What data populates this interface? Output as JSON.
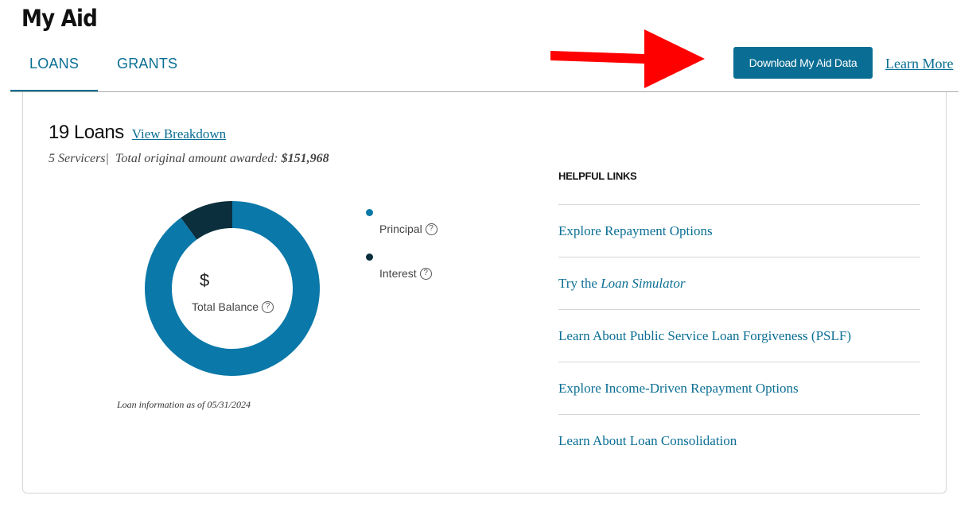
{
  "page": {
    "title": "My Aid"
  },
  "tabs": [
    {
      "label": "LOANS",
      "active": true
    },
    {
      "label": "GRANTS",
      "active": false
    }
  ],
  "actions": {
    "download_label": "Download My Aid Data",
    "learn_more_label": "Learn More"
  },
  "colors": {
    "accent": "#0a6e94",
    "principal": "#0a78a8",
    "interest": "#0b2f3c",
    "arrow": "#ff0000"
  },
  "summary": {
    "loans_count": "19 Loans",
    "view_breakdown_label": "View Breakdown",
    "servicers": "5 Servicers",
    "total_awarded_label": "Total original amount awarded:",
    "total_awarded_value": "$151,968"
  },
  "chart_data": {
    "type": "pie",
    "categories": [
      "Principal",
      "Interest"
    ],
    "values": [
      90,
      10
    ],
    "center_symbol": "$",
    "center_label": "Total Balance",
    "note": "Loan information as of 05/31/2024"
  },
  "helpful_links": {
    "heading": "HELPFUL LINKS",
    "items": [
      {
        "label": "Explore Repayment Options"
      },
      {
        "label_prefix": "Try the ",
        "label_italic": "Loan Simulator"
      },
      {
        "label": "Learn About Public Service Loan Forgiveness (PSLF)"
      },
      {
        "label": "Explore Income-Driven Repayment Options"
      },
      {
        "label": "Learn About Loan Consolidation"
      }
    ]
  }
}
